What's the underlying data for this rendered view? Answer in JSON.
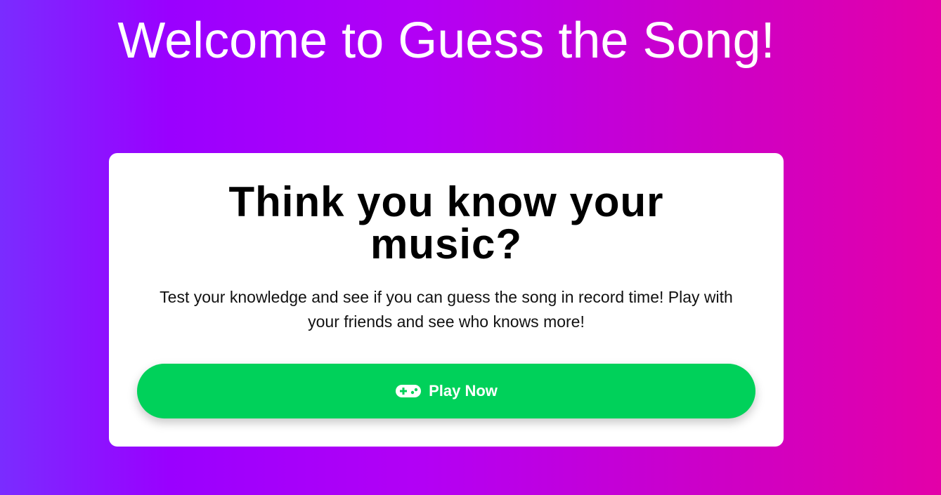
{
  "page": {
    "title": "Welcome to Guess the Song!"
  },
  "card": {
    "headline": "Think you know your music?",
    "description": "Test your knowledge and see if you can guess the song in record time! Play with your friends and see who knows more!",
    "play_button": {
      "label": "Play Now",
      "icon": "gamepad-icon"
    }
  },
  "colors": {
    "gradient_start": "#7a2cff",
    "gradient_end": "#e300a8",
    "button_bg": "#00d15a",
    "card_bg": "#ffffff"
  }
}
